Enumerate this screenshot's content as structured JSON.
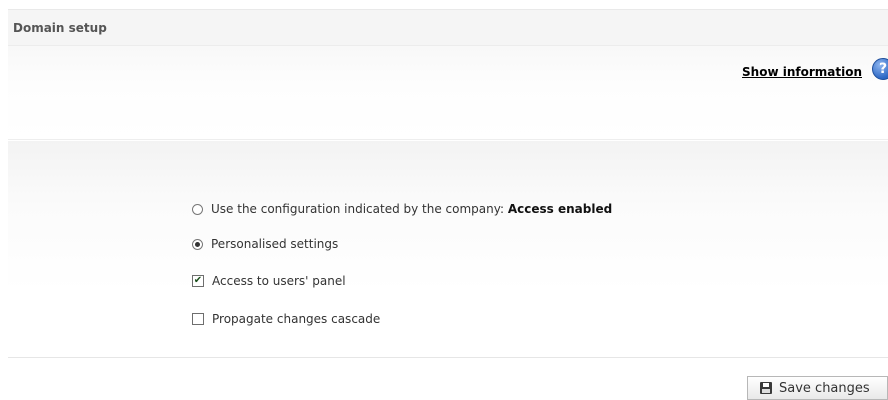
{
  "header": {
    "title": "Domain setup"
  },
  "info": {
    "link_label": "Show information",
    "help_icon": "help-icon",
    "help_glyph": "?"
  },
  "options": {
    "company_config": {
      "label_prefix": "Use the configuration indicated by the company:",
      "label_value": "Access enabled",
      "selected": false
    },
    "personalised": {
      "label": "Personalised settings",
      "selected": true
    },
    "users_panel": {
      "label": "Access to users' panel",
      "checked": true,
      "check_glyph": "✔"
    },
    "propagate": {
      "label": "Propagate changes cascade",
      "checked": false
    }
  },
  "actions": {
    "save_label": "Save changes",
    "save_icon": "floppy-disk-icon"
  }
}
